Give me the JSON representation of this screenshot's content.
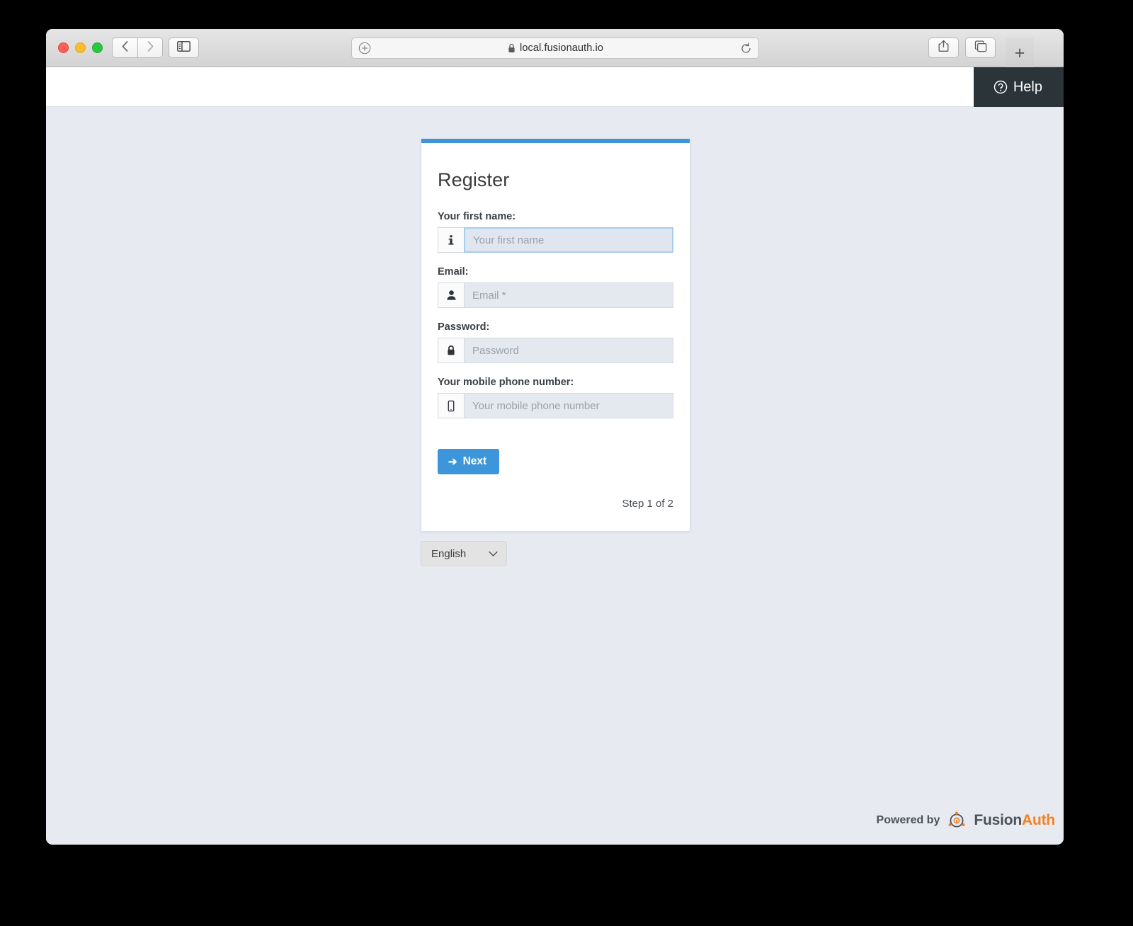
{
  "browser": {
    "url": "local.fusionauth.io",
    "lock_icon": "lock-icon",
    "reload_icon": "reload-icon",
    "back_icon": "chevron-left-icon",
    "forward_icon": "chevron-right-icon",
    "sidebar_icon": "sidebar-toggle-icon",
    "share_icon": "share-icon",
    "tabs_icon": "tab-overview-icon",
    "new_tab_label": "+",
    "url_add_icon": "add-circle-icon"
  },
  "header": {
    "help_label": "Help",
    "help_icon": "question-circle-icon"
  },
  "card": {
    "title": "Register",
    "accent_color": "#3d96d9",
    "fields": [
      {
        "label": "Your first name:",
        "placeholder": "Your first name",
        "icon": "info-icon",
        "icon_glyph": "i",
        "name": "first-name",
        "focused": true,
        "type": "text"
      },
      {
        "label": "Email:",
        "placeholder": "Email *",
        "icon": "user-icon",
        "name": "email",
        "focused": false,
        "type": "text"
      },
      {
        "label": "Password:",
        "placeholder": "Password",
        "icon": "lock-icon",
        "name": "password",
        "focused": false,
        "type": "password"
      },
      {
        "label": "Your mobile phone number:",
        "placeholder": "Your mobile phone number",
        "icon": "mobile-phone-icon",
        "name": "mobile-phone",
        "focused": false,
        "type": "text"
      }
    ],
    "next_label": "Next",
    "next_icon": "arrow-right-icon",
    "step_text": "Step 1 of 2"
  },
  "language": {
    "selected": "English",
    "chevron_icon": "chevron-down-icon"
  },
  "footer": {
    "powered_by": "Powered by",
    "brand_first": "Fusion",
    "brand_second": "Auth",
    "brand_color": "#f58220",
    "logo_icon": "fusionauth-logo-icon"
  }
}
